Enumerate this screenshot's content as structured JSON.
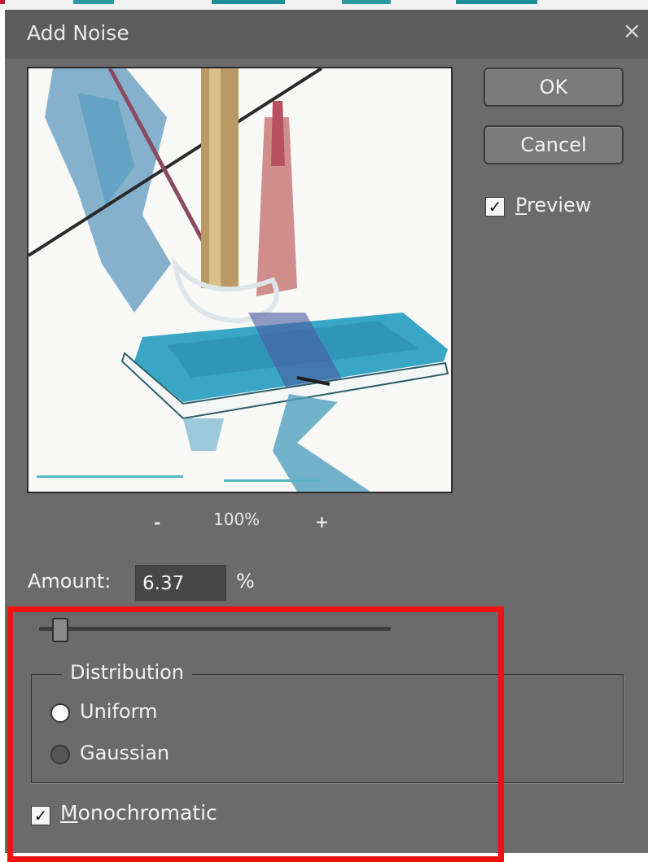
{
  "dialog": {
    "title": "Add Noise",
    "close_glyph": "×"
  },
  "preview": {
    "zoom_out": "-",
    "zoom_level": "100%",
    "zoom_in": "+"
  },
  "buttons": {
    "ok": "OK",
    "cancel": "Cancel"
  },
  "preview_toggle": {
    "checked": true,
    "label_access_key": "P",
    "label_rest": "review"
  },
  "amount": {
    "label": "Amount:",
    "value": "6.37",
    "unit": "%"
  },
  "slider": {
    "value_fraction": 0.06
  },
  "distribution": {
    "legend": "Distribution",
    "options": [
      {
        "label": "Uniform",
        "selected": true
      },
      {
        "label": "Gaussian",
        "selected": false
      }
    ]
  },
  "monochromatic": {
    "checked": true,
    "label_access_key": "M",
    "label_rest": "onochromatic"
  },
  "icons": {
    "check": "✓",
    "close": "close-icon"
  },
  "colors": {
    "dialog_bg": "#6b6b6b",
    "titlebar_bg": "#5d5d5d",
    "highlight_border": "#ee1111"
  }
}
